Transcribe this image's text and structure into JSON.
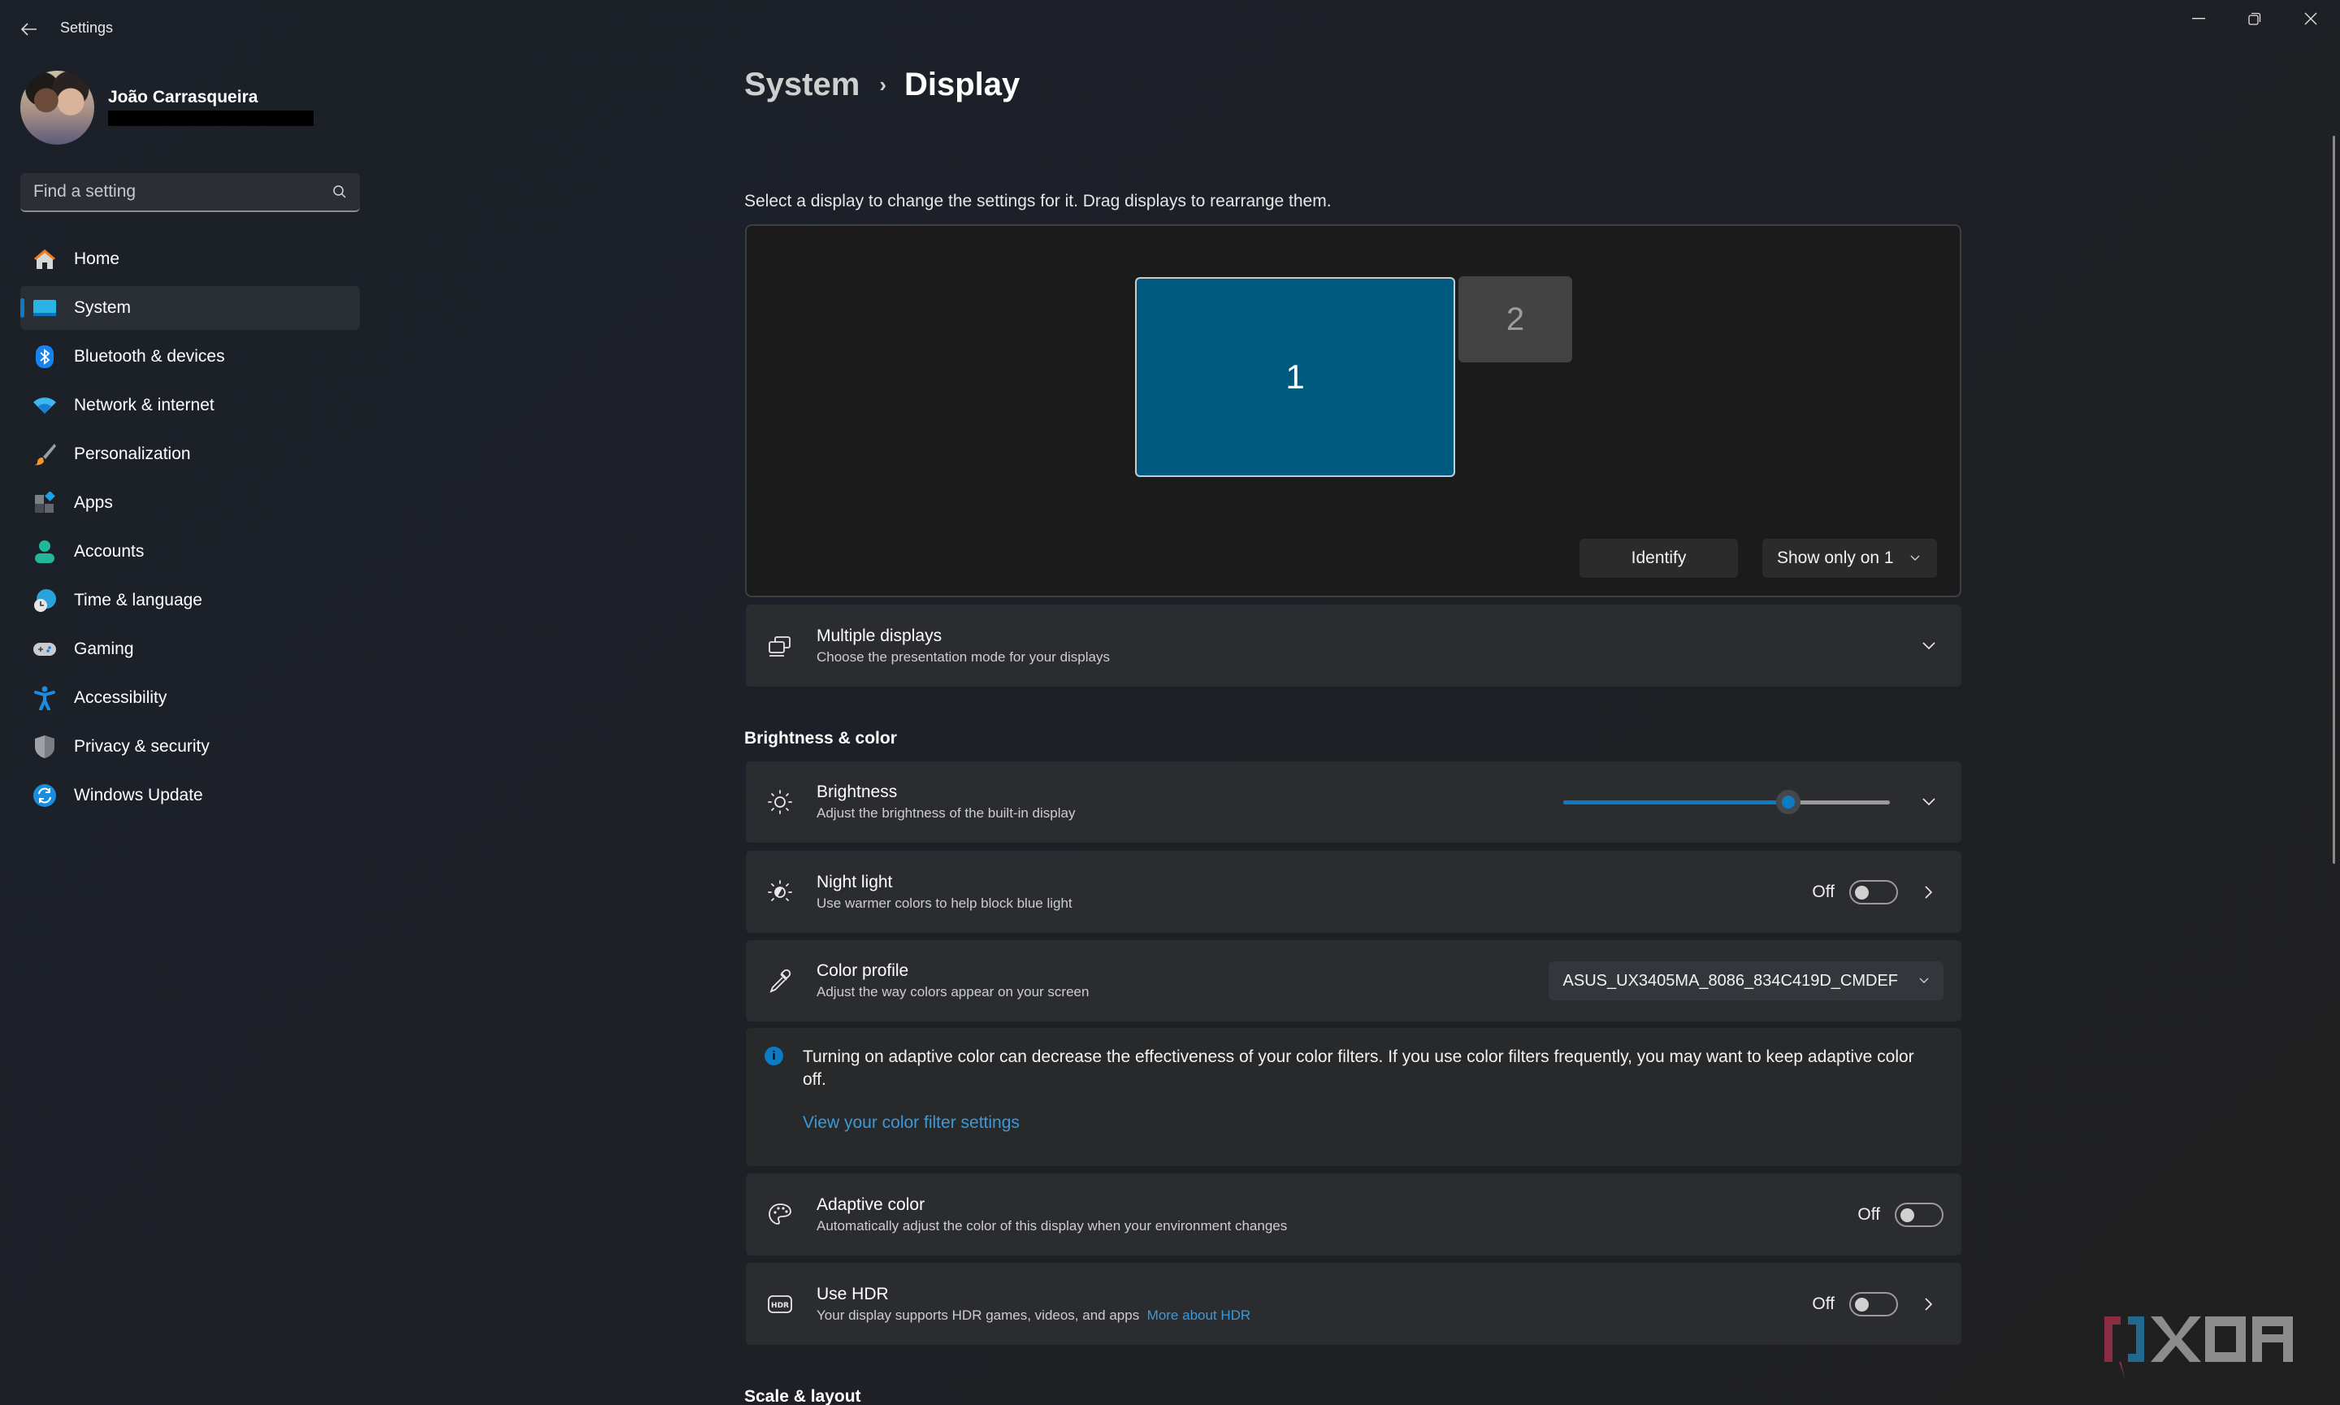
{
  "window": {
    "title": "Settings",
    "controls": {
      "minimize": "minimize-icon",
      "restore": "restore-icon",
      "close": "close-icon"
    }
  },
  "profile": {
    "name": "João Carrasqueira",
    "email_redacted": true
  },
  "search": {
    "placeholder": "Find a setting",
    "value": ""
  },
  "sidebar": {
    "items": [
      {
        "label": "Home",
        "icon": "home-icon",
        "active": false
      },
      {
        "label": "System",
        "icon": "system-icon",
        "active": true
      },
      {
        "label": "Bluetooth & devices",
        "icon": "bluetooth-icon",
        "active": false
      },
      {
        "label": "Network & internet",
        "icon": "wifi-icon",
        "active": false
      },
      {
        "label": "Personalization",
        "icon": "brush-icon",
        "active": false
      },
      {
        "label": "Apps",
        "icon": "apps-icon",
        "active": false
      },
      {
        "label": "Accounts",
        "icon": "account-icon",
        "active": false
      },
      {
        "label": "Time & language",
        "icon": "globe-clock-icon",
        "active": false
      },
      {
        "label": "Gaming",
        "icon": "gamepad-icon",
        "active": false
      },
      {
        "label": "Accessibility",
        "icon": "accessibility-icon",
        "active": false
      },
      {
        "label": "Privacy & security",
        "icon": "shield-icon",
        "active": false
      },
      {
        "label": "Windows Update",
        "icon": "update-icon",
        "active": false
      }
    ]
  },
  "breadcrumb": {
    "parent": "System",
    "separator": "›",
    "current": "Display"
  },
  "arrangement": {
    "description": "Select a display to change the settings for it. Drag displays to rearrange them.",
    "monitors": [
      {
        "number": "1",
        "selected": true
      },
      {
        "number": "2",
        "selected": false
      }
    ],
    "identify_label": "Identify",
    "mode_select": "Show only on 1"
  },
  "multiple_displays": {
    "title": "Multiple displays",
    "subtitle": "Choose the presentation mode for your displays"
  },
  "brightness_color": {
    "section_label": "Brightness & color",
    "brightness": {
      "title": "Brightness",
      "subtitle": "Adjust the brightness of the built-in display",
      "value_percent": 69
    },
    "night_light": {
      "title": "Night light",
      "subtitle": "Use warmer colors to help block blue light",
      "state": "Off"
    },
    "color_profile": {
      "title": "Color profile",
      "subtitle": "Adjust the way colors appear on your screen",
      "selected": "ASUS_UX3405MA_8086_834C419D_CMDEF"
    },
    "info": {
      "text": "Turning on adaptive color can decrease the effectiveness of your color filters. If you use color filters frequently, you may want to keep adaptive color off.",
      "link": "View your color filter settings"
    },
    "adaptive_color": {
      "title": "Adaptive color",
      "subtitle": "Automatically adjust the color of this display when your environment changes",
      "state": "Off"
    },
    "hdr": {
      "title": "Use HDR",
      "subtitle": "Your display supports HDR games, videos, and apps",
      "link": "More about HDR",
      "state": "Off"
    }
  },
  "scale_layout": {
    "section_label": "Scale & layout"
  },
  "colors": {
    "accent": "#0b7bc4",
    "monitor_selected": "#005a80",
    "link": "#3a9ad9"
  },
  "watermark": "XDA"
}
